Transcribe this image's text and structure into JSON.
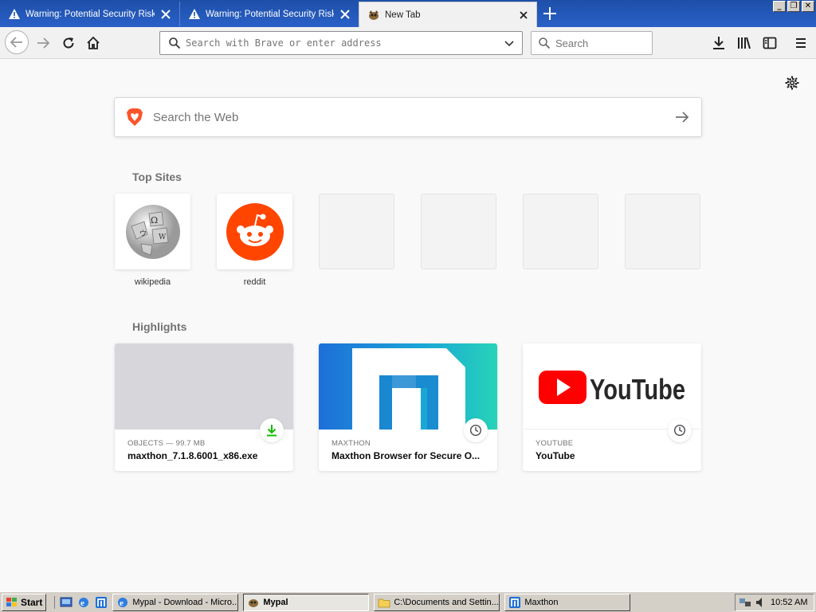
{
  "tabs": [
    {
      "title": "Warning: Potential Security Risk A",
      "icon": "warning-icon",
      "active": false
    },
    {
      "title": "Warning: Potential Security Risk A",
      "icon": "warning-icon",
      "active": false
    },
    {
      "title": "New Tab",
      "icon": "mypal-icon",
      "active": true
    }
  ],
  "toolbar": {
    "url_placeholder": "Search with Brave or enter address",
    "search_placeholder": "Search"
  },
  "newtab": {
    "websearch_placeholder": "Search the Web",
    "top_sites_title": "Top Sites",
    "top_sites": [
      {
        "label": "wikipedia",
        "icon": "wikipedia-icon"
      },
      {
        "label": "reddit",
        "icon": "reddit-icon"
      },
      {
        "label": "",
        "icon": ""
      },
      {
        "label": "",
        "icon": ""
      },
      {
        "label": "",
        "icon": ""
      },
      {
        "label": "",
        "icon": ""
      }
    ],
    "highlights_title": "Highlights",
    "highlights": [
      {
        "meta": "OBJECTS — 99.7 MB",
        "title": "maxthon_7.1.8.6001_x86.exe",
        "badge": "download-icon"
      },
      {
        "meta": "MAXTHON",
        "title": "Maxthon Browser for Secure O...",
        "badge": "clock-icon"
      },
      {
        "meta": "YOUTUBE",
        "title": "YouTube",
        "badge": "clock-icon"
      }
    ]
  },
  "taskbar": {
    "start_label": "Start",
    "tasks": [
      {
        "label": "Mypal - Download - Micro...",
        "active": false
      },
      {
        "label": "Mypal",
        "active": true
      },
      {
        "label": "C:\\Documents and Settin...",
        "active": false
      },
      {
        "label": "Maxthon",
        "active": false
      }
    ],
    "clock": "10:52 AM"
  },
  "colors": {
    "tabstrip": "#2a61c8",
    "reddit": "#ff4500",
    "youtube_red": "#ff0000",
    "maxthon_blue": "#1e6fd9",
    "download_green": "#12bc00"
  }
}
